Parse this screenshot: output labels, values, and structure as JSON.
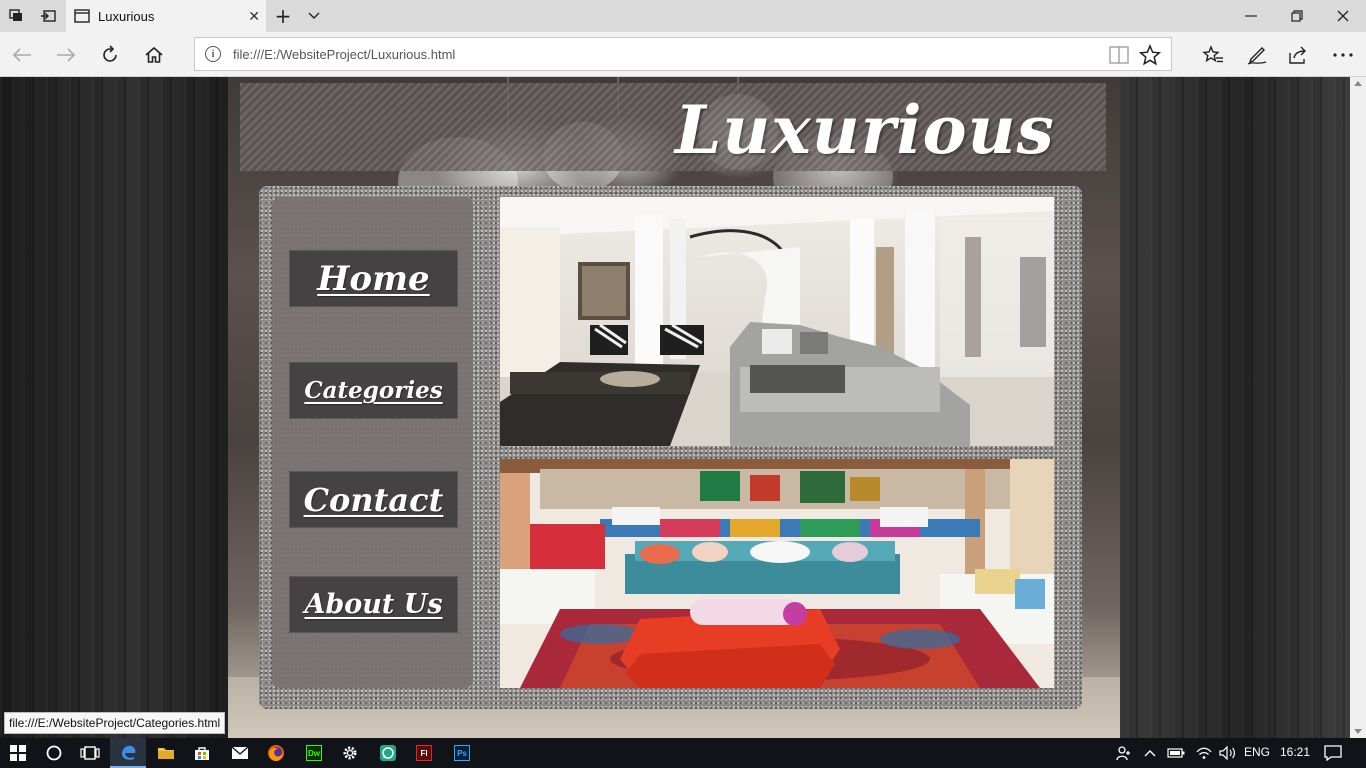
{
  "browser": {
    "tab_title": "Luxurious",
    "url": "file:///E:/WebsiteProject/Luxurious.html"
  },
  "page": {
    "site_title": "Luxurious",
    "menu": [
      {
        "label": "Home"
      },
      {
        "label": "Categories"
      },
      {
        "label": "Contact"
      },
      {
        "label": "About Us"
      }
    ]
  },
  "status_bar": {
    "link_preview": "file:///E:/WebsiteProject/Categories.html"
  },
  "taskbar": {
    "apps": [
      {
        "icon": "dreamweaver-icon",
        "label": "Dw",
        "color": "#35fa00"
      },
      {
        "icon": "flash-icon",
        "label": "Fl",
        "color": "#e0271c"
      },
      {
        "icon": "photoshop-icon",
        "label": "Ps",
        "color": "#31a8ff"
      }
    ],
    "language": "ENG",
    "time": "16:21"
  }
}
